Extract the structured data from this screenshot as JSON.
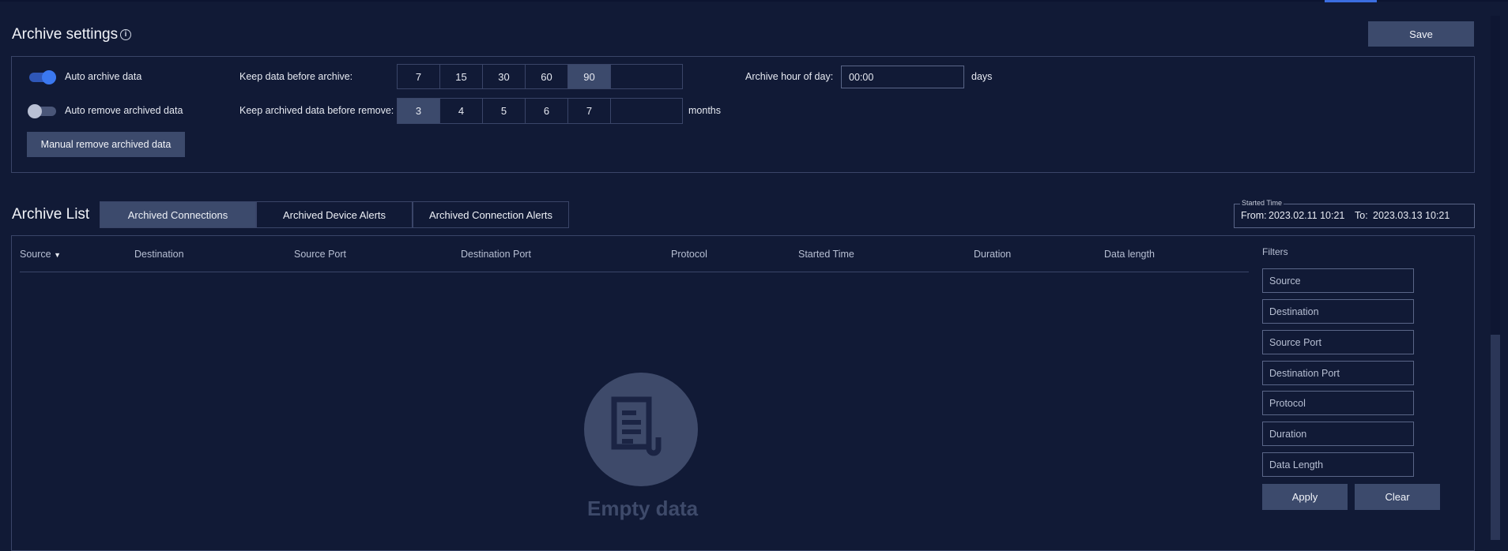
{
  "archive_settings": {
    "title": "Archive settings",
    "save_label": "Save",
    "auto_archive_label": "Auto archive data",
    "auto_archive_on": true,
    "auto_remove_label": "Auto remove archived data",
    "auto_remove_on": false,
    "manual_remove_label": "Manual remove archived data",
    "keep_before_archive_label": "Keep data before archive:",
    "keep_before_archive_options": [
      "7",
      "15",
      "30",
      "60",
      "90"
    ],
    "keep_before_archive_selected": "90",
    "keep_before_archive_custom": "",
    "keep_before_archive_unit": "days",
    "keep_before_remove_label": "Keep archived data before remove:",
    "keep_before_remove_options": [
      "3",
      "4",
      "5",
      "6",
      "7"
    ],
    "keep_before_remove_selected": "3",
    "keep_before_remove_custom": "",
    "keep_before_remove_unit": "months",
    "archive_hour_label": "Archive hour of day:",
    "archive_hour_value": "00:00"
  },
  "archive_list": {
    "title": "Archive List",
    "tabs": [
      {
        "label": "Archived Connections",
        "active": true
      },
      {
        "label": "Archived Device Alerts",
        "active": false
      },
      {
        "label": "Archived Connection Alerts",
        "active": false
      }
    ],
    "started_time": {
      "legend": "Started Time",
      "from_label": "From:",
      "from_value": "2023.02.11 10:21",
      "to_label": "To:",
      "to_value": "2023.03.13 10:21"
    },
    "columns": [
      "Source",
      "Destination",
      "Source Port",
      "Destination Port",
      "Protocol",
      "Started Time",
      "Duration",
      "Data length"
    ],
    "sort_column": "Source",
    "empty_text": "Empty data",
    "filters": {
      "title": "Filters",
      "fields": [
        "Source",
        "Destination",
        "Source Port",
        "Destination Port",
        "Protocol",
        "Duration",
        "Data Length"
      ],
      "apply_label": "Apply",
      "clear_label": "Clear"
    }
  },
  "colors": {
    "background": "#111a36",
    "accent": "#3b6de0",
    "selected": "#3c4a6c"
  }
}
